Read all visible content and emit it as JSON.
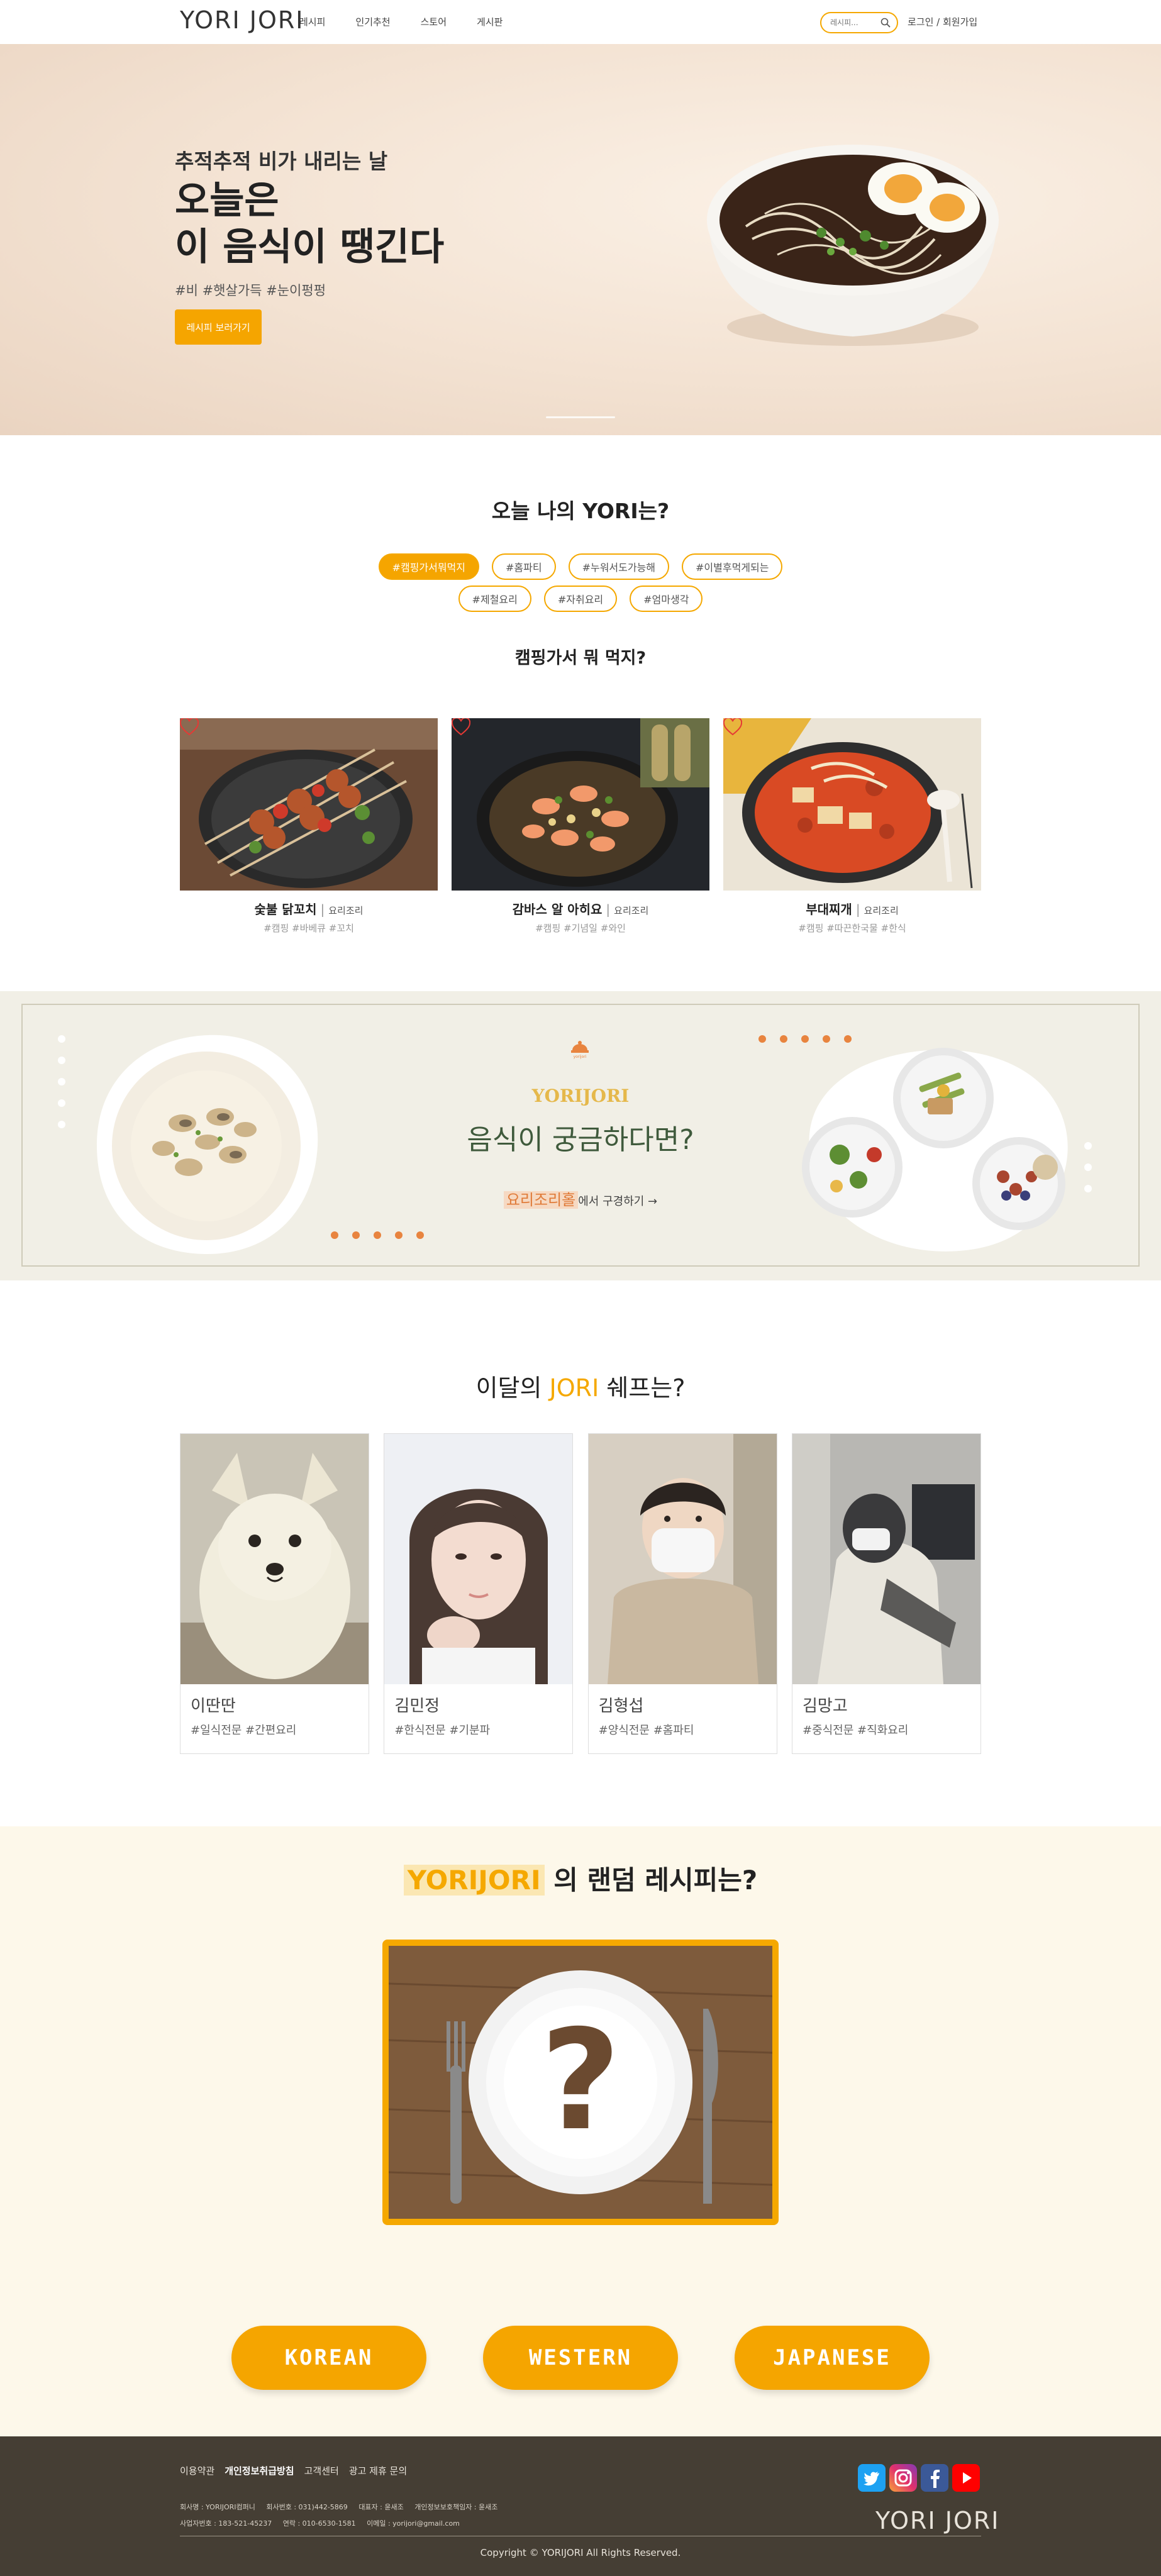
{
  "header": {
    "logo": "YORI JORI",
    "nav": [
      "레시피",
      "인기추천",
      "스토어",
      "게시판"
    ],
    "search_placeholder": "레시피...",
    "auth": "로그인 / 회원가입"
  },
  "hero": {
    "kicker": "추적추적 비가 내리는 날",
    "title": "오늘은\n이 음식이 땡긴다",
    "tags": "#비 #햇살가득 #눈이펑펑",
    "button": "레시피 보러가기"
  },
  "today": {
    "title": "오늘 나의 YORI는?",
    "chips_row1": [
      "#캠핑가서뭐먹지",
      "#홈파티",
      "#누워서도가능해",
      "#이별후먹게되는"
    ],
    "chips_row2": [
      "#제철요리",
      "#자취요리",
      "#엄마생각"
    ],
    "active_chip": "#캠핑가서뭐먹지",
    "subtitle": "캠핑가서 뭐 먹지?",
    "cards": [
      {
        "name": "숯불 닭꼬치",
        "type": "요리조리",
        "tags": "#캠핑 #바베큐 #꼬치"
      },
      {
        "name": "감바스 알 아히요",
        "type": "요리조리",
        "tags": "#캠핑 #기념일 #와인"
      },
      {
        "name": "부대찌개",
        "type": "요리조리",
        "tags": "#캠핑 #따끈한국물 #한식"
      }
    ]
  },
  "promo": {
    "icon_label": "yorijori",
    "brand": "YORIJORI",
    "title": "음식이 궁금하다면?",
    "link_highlight": "요리조리홀",
    "link_rest": "에서 구경하기 →"
  },
  "chefs": {
    "title_pre": "이달의 ",
    "title_accent": "JORI",
    "title_post": " 쉐프는?",
    "list": [
      {
        "name": "이딴딴",
        "tags": "#일식전문 #간편요리"
      },
      {
        "name": "김민정",
        "tags": "#한식전문 #기분파"
      },
      {
        "name": "김형섭",
        "tags": "#양식전문 #홈파티"
      },
      {
        "name": "김망고",
        "tags": "#중식전문 #직화요리"
      }
    ]
  },
  "random": {
    "title_highlight": "YORIJORI",
    "title_rest": " 의 랜덤 레시피는?",
    "buttons": [
      "KOREAN",
      "WESTERN",
      "JAPANESE"
    ]
  },
  "footer": {
    "links": [
      "이용약관",
      "개인정보취급방침",
      "고객센터",
      "광고 제휴 문의"
    ],
    "info_row1": [
      "회사명 : YORIJORI컴퍼니",
      "회사번호 : 031)442-5869",
      "대표자 : 윤새조",
      "개인정보보호책임자 : 윤새조"
    ],
    "info_row2": [
      "사업자번호 : 183-521-45237",
      "연락 : 010-6530-1581",
      "이메일 : yorijori@gmail.com"
    ],
    "logo": "YORI JORI",
    "copyright": "Copyright © YORIJORI All Rights Reserved."
  },
  "colors": {
    "accent": "#f5a500",
    "footer_bg": "#453e34",
    "promo_bg": "#f1efe6",
    "random_bg": "#fdf8ea"
  },
  "icons": [
    "search-icon",
    "heart-icon",
    "twitter-icon",
    "instagram-icon",
    "facebook-icon",
    "youtube-icon",
    "question-mark-icon"
  ]
}
